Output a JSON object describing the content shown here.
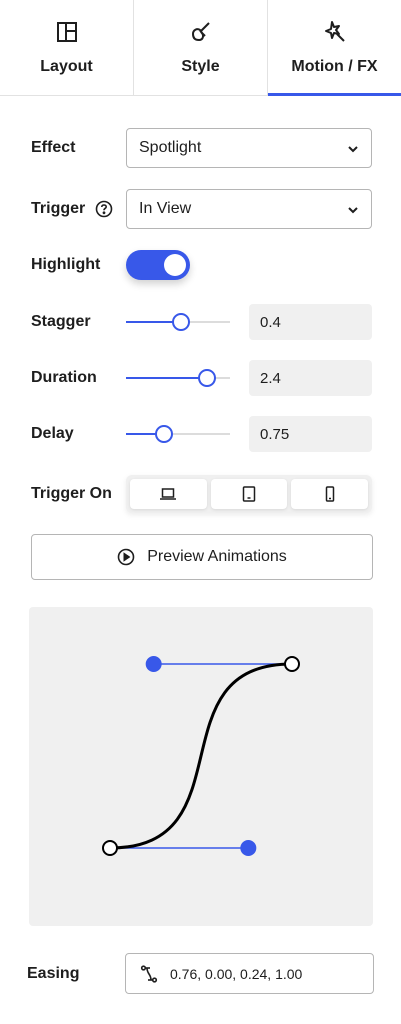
{
  "tabs": [
    {
      "label": "Layout",
      "icon": "layout-icon",
      "active": false
    },
    {
      "label": "Style",
      "icon": "brush-icon",
      "active": false
    },
    {
      "label": "Motion / FX",
      "icon": "magic-wand-icon",
      "active": true
    }
  ],
  "effect": {
    "label": "Effect",
    "value": "Spotlight"
  },
  "trigger": {
    "label": "Trigger",
    "value": "In View"
  },
  "highlight": {
    "label": "Highlight",
    "enabled": true
  },
  "stagger": {
    "label": "Stagger",
    "value": "0.4",
    "level": 0.53
  },
  "duration": {
    "label": "Duration",
    "value": "2.4",
    "level": 0.78
  },
  "delay": {
    "label": "Delay",
    "value": "0.75",
    "level": 0.37
  },
  "trigger_on": {
    "label": "Trigger On",
    "devices": [
      "desktop-icon",
      "tablet-icon",
      "mobile-icon"
    ]
  },
  "preview": {
    "label": "Preview Animations"
  },
  "easing": {
    "label": "Easing",
    "value": "0.76, 0.00, 0.24, 1.00",
    "points": [
      0.76,
      0.0,
      0.24,
      1.0
    ]
  },
  "colors": {
    "accent": "#3858e9",
    "panel": "#f0f0f0"
  }
}
